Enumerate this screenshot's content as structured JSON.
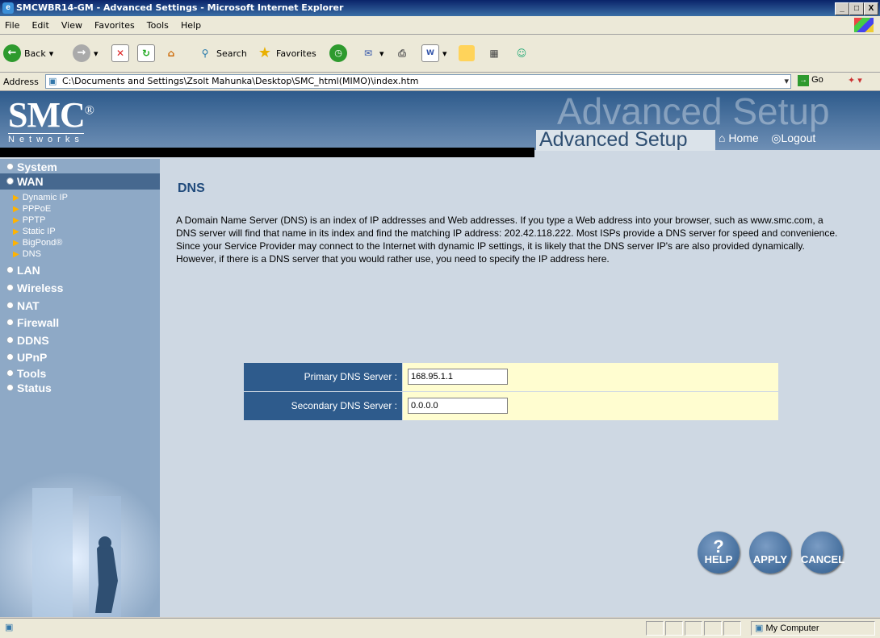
{
  "window": {
    "title": "SMCWBR14-GM - Advanced Settings - Microsoft Internet Explorer",
    "controls": [
      "_",
      "□",
      "X"
    ]
  },
  "menu": [
    "File",
    "Edit",
    "View",
    "Favorites",
    "Tools",
    "Help"
  ],
  "toolbar": {
    "back": "Back",
    "search": "Search",
    "favorites": "Favorites"
  },
  "address": {
    "label": "Address",
    "value": "C:\\Documents and Settings\\Zsolt Mahunka\\Desktop\\SMC_html(MIMO)\\index.htm",
    "go": "Go"
  },
  "header": {
    "brand": "SMC",
    "reg": "®",
    "sub": "Networks",
    "ghost": "Advanced Setup",
    "title": "Advanced Setup",
    "home": "Home",
    "logout": "Logout"
  },
  "sidebar": {
    "items": [
      "System",
      "WAN",
      "LAN",
      "Wireless",
      "NAT",
      "Firewall",
      "DDNS",
      "UPnP",
      "Tools",
      "Status"
    ],
    "wan_sub": [
      "Dynamic IP",
      "PPPoE",
      "PPTP",
      "Static IP",
      "BigPond®",
      "DNS"
    ]
  },
  "content": {
    "title": "DNS",
    "description": "A Domain Name Server (DNS) is an index of IP addresses and Web addresses. If you type a Web address into your browser, such as www.smc.com, a DNS server will find that name in its index and find the matching IP address: 202.42.118.222. Most ISPs provide a DNS server for speed and convenience. Since your Service Provider may connect to the Internet with dynamic IP settings, it is likely that the DNS server IP's are also provided dynamically. However, if there is a DNS server that you would rather use, you need to specify the IP address here.",
    "primary_label": "Primary DNS Server :",
    "primary_value": "168.95.1.1",
    "secondary_label": "Secondary DNS Server :",
    "secondary_value": "0.0.0.0"
  },
  "buttons": {
    "help": "HELP",
    "apply": "APPLY",
    "cancel": "CANCEL"
  },
  "status": {
    "zone": "My Computer"
  }
}
